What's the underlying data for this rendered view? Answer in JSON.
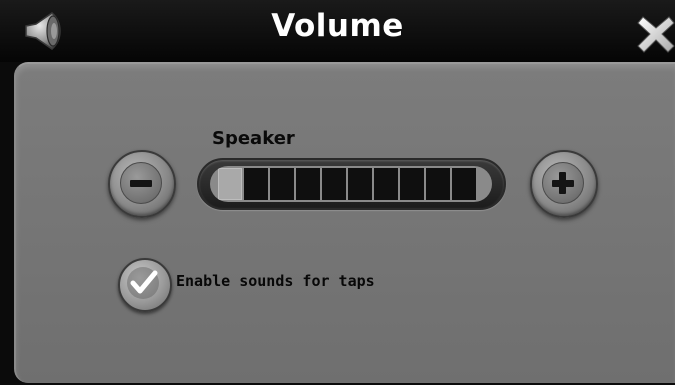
{
  "window": {
    "title": "Volume",
    "title_icon": "speaker-icon",
    "close_icon": "close-icon"
  },
  "volume": {
    "label": "Speaker",
    "level": 1,
    "max_level": 10,
    "decrease_icon": "minus-icon",
    "increase_icon": "plus-icon"
  },
  "options": {
    "tap_sounds_label": "Enable sounds for taps",
    "tap_sounds_checked": true,
    "check_icon": "checkmark-icon"
  },
  "colors": {
    "panel": "#767676",
    "titlebar": "#0b0b0b",
    "title_text": "#ffffff",
    "segment_on": "#a9a9a9",
    "segment_off": "#0f0f0f"
  }
}
